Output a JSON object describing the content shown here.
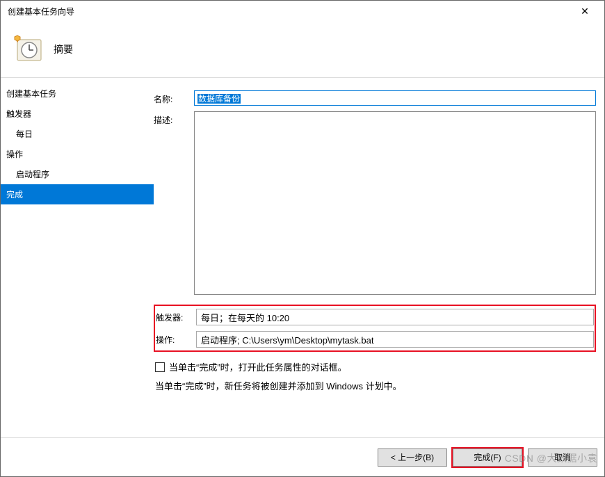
{
  "window": {
    "title": "创建基本任务向导",
    "close": "✕"
  },
  "header": {
    "title": "摘要"
  },
  "sidebar": {
    "items": [
      {
        "label": "创建基本任务",
        "indent": false,
        "selected": false
      },
      {
        "label": "触发器",
        "indent": false,
        "selected": false
      },
      {
        "label": "每日",
        "indent": true,
        "selected": false
      },
      {
        "label": "操作",
        "indent": false,
        "selected": false
      },
      {
        "label": "启动程序",
        "indent": true,
        "selected": false
      },
      {
        "label": "完成",
        "indent": false,
        "selected": true
      }
    ]
  },
  "form": {
    "name_label": "名称:",
    "name_value": "数据库备份",
    "desc_label": "描述:",
    "desc_value": ""
  },
  "summary": {
    "trigger_label": "触发器:",
    "trigger_value": "每日；在每天的 10:20",
    "action_label": "操作:",
    "action_value": "启动程序; C:\\Users\\ym\\Desktop\\mytask.bat"
  },
  "checkbox": {
    "label": "当单击“完成”时，打开此任务属性的对话框。"
  },
  "info_text": "当单击“完成”时，新任务将被创建并添加到 Windows 计划中。",
  "buttons": {
    "back": "< 上一步(B)",
    "finish": "完成(F)",
    "cancel": "取消"
  },
  "watermark": "CSDN @大数据小袁"
}
